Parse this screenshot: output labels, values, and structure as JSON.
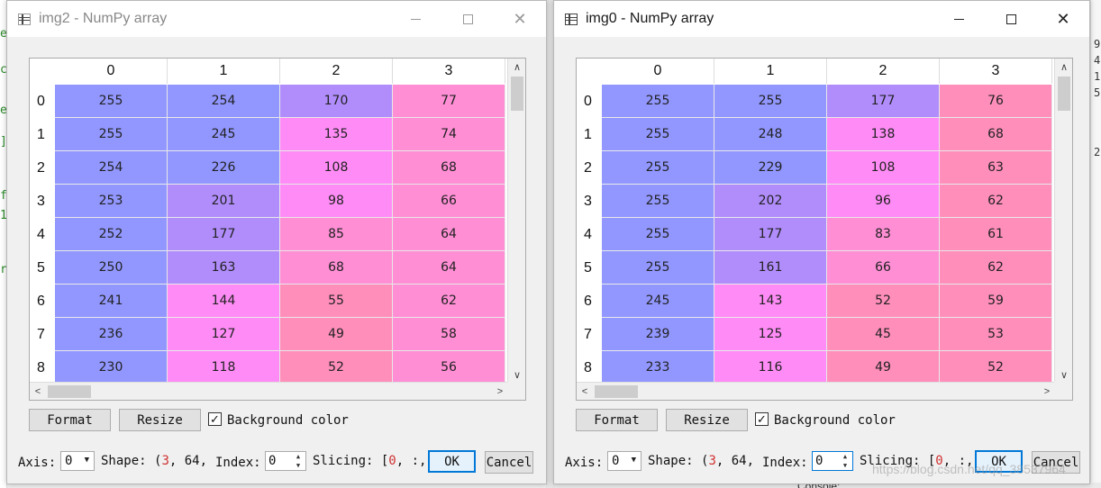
{
  "colors": {
    "blue": "#9297ff",
    "violet": "#b18dfc",
    "magenta": "#ff8cf6",
    "pink": "#ff8ed5",
    "rose": "#ff8ebb",
    "active_border": "#0078d7"
  },
  "background_app": {
    "left_chars": [
      "e",
      "c",
      "e",
      "]",
      "f",
      "1",
      "r"
    ],
    "right_chars": [
      "9",
      "4",
      "1",
      "5",
      "2"
    ],
    "console_label": "Console:",
    "watermark": "https://blog.csdn.net/qq_38537964"
  },
  "windows": [
    {
      "title": "img2 - NumPy array",
      "active": false,
      "columns": [
        "0",
        "1",
        "2",
        "3"
      ],
      "rows": [
        {
          "label": "0",
          "values": [
            "255",
            "254",
            "170",
            "77"
          ],
          "colors": [
            "blue",
            "blue",
            "violet",
            "pink"
          ]
        },
        {
          "label": "1",
          "values": [
            "255",
            "245",
            "135",
            "74"
          ],
          "colors": [
            "blue",
            "blue",
            "magenta",
            "pink"
          ]
        },
        {
          "label": "2",
          "values": [
            "254",
            "226",
            "108",
            "68"
          ],
          "colors": [
            "blue",
            "blue",
            "magenta",
            "pink"
          ]
        },
        {
          "label": "3",
          "values": [
            "253",
            "201",
            "98",
            "66"
          ],
          "colors": [
            "blue",
            "violet",
            "magenta",
            "pink"
          ]
        },
        {
          "label": "4",
          "values": [
            "252",
            "177",
            "85",
            "64"
          ],
          "colors": [
            "blue",
            "violet",
            "pink",
            "pink"
          ]
        },
        {
          "label": "5",
          "values": [
            "250",
            "163",
            "68",
            "64"
          ],
          "colors": [
            "blue",
            "violet",
            "pink",
            "pink"
          ]
        },
        {
          "label": "6",
          "values": [
            "241",
            "144",
            "55",
            "62"
          ],
          "colors": [
            "blue",
            "magenta",
            "rose",
            "pink"
          ]
        },
        {
          "label": "7",
          "values": [
            "236",
            "127",
            "49",
            "58"
          ],
          "colors": [
            "blue",
            "magenta",
            "rose",
            "pink"
          ]
        },
        {
          "label": "8",
          "values": [
            "230",
            "118",
            "52",
            "56"
          ],
          "colors": [
            "blue",
            "magenta",
            "rose",
            "pink"
          ]
        }
      ],
      "format_label": "Format",
      "resize_label": "Resize",
      "bg_color_label": "Background color",
      "bg_color_checked": true,
      "axis_label": "Axis:",
      "axis_value": "0",
      "shape_label": "Shape: (",
      "shape_first": "3",
      "shape_rest": ", 64,",
      "index_label": "Index:",
      "index_value": "0",
      "slicing_label": "Slicing: [",
      "slicing_first": "0",
      "slicing_rest": ", :,",
      "ok_label": "OK",
      "cancel_label": "Cancel"
    },
    {
      "title": "img0 - NumPy array",
      "active": true,
      "columns": [
        "0",
        "1",
        "2",
        "3"
      ],
      "rows": [
        {
          "label": "0",
          "values": [
            "255",
            "255",
            "177",
            "76"
          ],
          "colors": [
            "blue",
            "blue",
            "violet",
            "rose"
          ]
        },
        {
          "label": "1",
          "values": [
            "255",
            "248",
            "138",
            "68"
          ],
          "colors": [
            "blue",
            "blue",
            "magenta",
            "rose"
          ]
        },
        {
          "label": "2",
          "values": [
            "255",
            "229",
            "108",
            "63"
          ],
          "colors": [
            "blue",
            "blue",
            "magenta",
            "rose"
          ]
        },
        {
          "label": "3",
          "values": [
            "255",
            "202",
            "96",
            "62"
          ],
          "colors": [
            "blue",
            "violet",
            "magenta",
            "rose"
          ]
        },
        {
          "label": "4",
          "values": [
            "255",
            "177",
            "83",
            "61"
          ],
          "colors": [
            "blue",
            "violet",
            "pink",
            "rose"
          ]
        },
        {
          "label": "5",
          "values": [
            "255",
            "161",
            "66",
            "62"
          ],
          "colors": [
            "blue",
            "violet",
            "pink",
            "rose"
          ]
        },
        {
          "label": "6",
          "values": [
            "245",
            "143",
            "52",
            "59"
          ],
          "colors": [
            "blue",
            "magenta",
            "rose",
            "rose"
          ]
        },
        {
          "label": "7",
          "values": [
            "239",
            "125",
            "45",
            "53"
          ],
          "colors": [
            "blue",
            "magenta",
            "rose",
            "rose"
          ]
        },
        {
          "label": "8",
          "values": [
            "233",
            "116",
            "49",
            "52"
          ],
          "colors": [
            "blue",
            "magenta",
            "rose",
            "rose"
          ]
        }
      ],
      "format_label": "Format",
      "resize_label": "Resize",
      "bg_color_label": "Background color",
      "bg_color_checked": true,
      "axis_label": "Axis:",
      "axis_value": "0",
      "shape_label": "Shape: (",
      "shape_first": "3",
      "shape_rest": ", 64,",
      "index_label": "Index:",
      "index_value": "0",
      "slicing_label": "Slicing: [",
      "slicing_first": "0",
      "slicing_rest": ", :,",
      "ok_label": "OK",
      "cancel_label": "Cancel"
    }
  ]
}
